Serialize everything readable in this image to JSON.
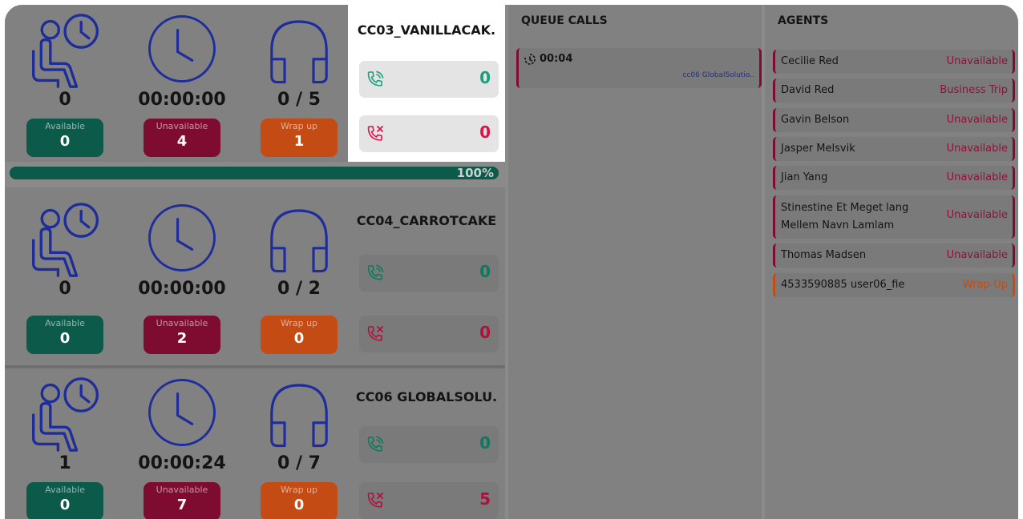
{
  "queues": [
    {
      "name": "CC03_VANILLACAK.",
      "waiting": "0",
      "wait_time": "00:00:00",
      "agents_ratio": "0 / 5",
      "available_label": "Available",
      "available": "0",
      "unavailable_label": "Unavailable",
      "unavailable": "4",
      "wrapup_label": "Wrap up",
      "wrapup": "1",
      "answered": "0",
      "missed": "0"
    },
    {
      "name": "CC04_CARROTCAKE",
      "waiting": "0",
      "wait_time": "00:00:00",
      "agents_ratio": "0 / 2",
      "available_label": "Available",
      "available": "0",
      "unavailable_label": "Unavailable",
      "unavailable": "2",
      "wrapup_label": "Wrap up",
      "wrapup": "0",
      "answered": "0",
      "missed": "0"
    },
    {
      "name": "CC06 GLOBALSOLU.",
      "waiting": "1",
      "wait_time": "00:00:24",
      "agents_ratio": "0 / 7",
      "available_label": "Available",
      "available": "0",
      "unavailable_label": "Unavailable",
      "unavailable": "7",
      "wrapup_label": "Wrap up",
      "wrapup": "0",
      "answered": "0",
      "missed": "5"
    }
  ],
  "progress": {
    "label": "100%",
    "value": 1.0
  },
  "queue_calls": {
    "title": "QUEUE CALLS",
    "calls": [
      {
        "time": "00:04",
        "queue": "cc06 GlobalSolutio.."
      }
    ]
  },
  "agents": {
    "title": "AGENTS",
    "list": [
      {
        "name": "Cecilie Red",
        "status": "Unavailable"
      },
      {
        "name": "David Red",
        "status": "Business Trip"
      },
      {
        "name": "Gavin Belson",
        "status": "Unavailable"
      },
      {
        "name": "Jasper Melsvik",
        "status": "Unavailable"
      },
      {
        "name": "Jian Yang",
        "status": "Unavailable"
      },
      {
        "name": "Stinestine Et Meget lang Mellem Navn Lamlam",
        "status": "Unavailable"
      },
      {
        "name": "Thomas Madsen",
        "status": "Unavailable"
      },
      {
        "name": "4533590885 user06_fie",
        "status": "Wrap-Up"
      }
    ]
  },
  "colors": {
    "icon_blue": "#1e2d9a",
    "available_green": "#0b5a4a",
    "unavailable_red": "#7e0c30",
    "wrapup_orange": "#c44c14"
  }
}
